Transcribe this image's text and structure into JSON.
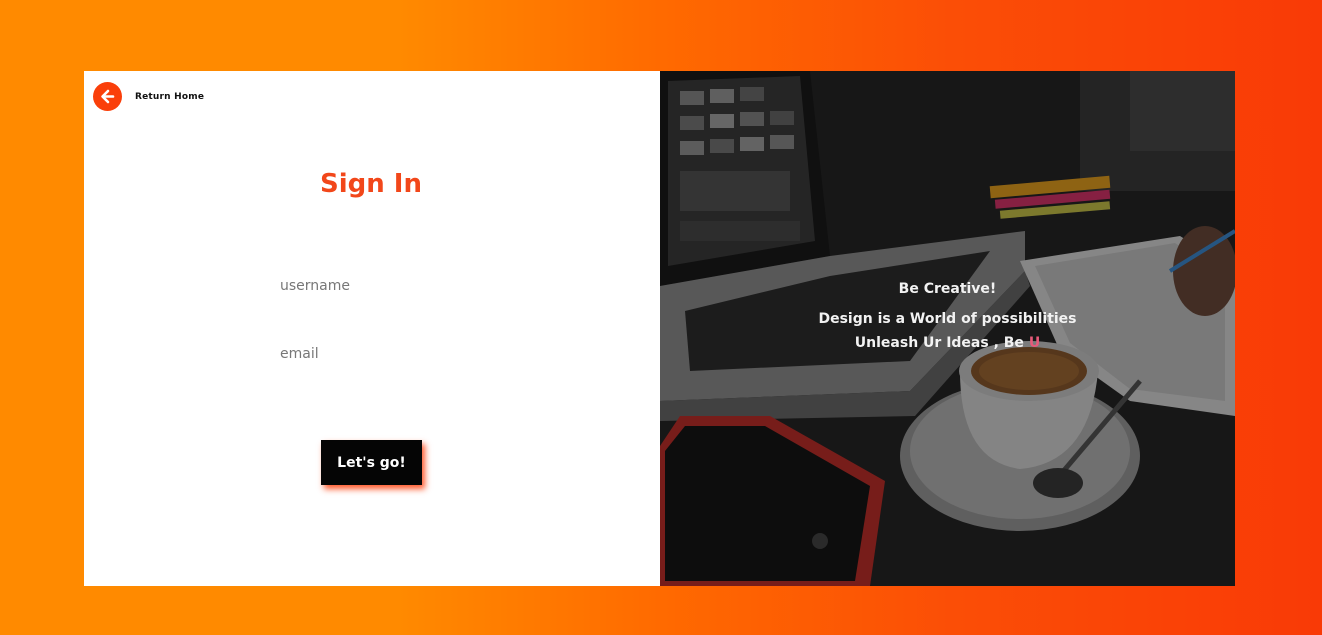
{
  "nav": {
    "return_label": "Return Home"
  },
  "form": {
    "title": "Sign In",
    "username_placeholder": "username",
    "email_placeholder": "email",
    "submit_label": "Let's go!"
  },
  "hero": {
    "line1": "Be Creative!",
    "line2": "Design is a World of possibilities",
    "line3_prefix": "Unleash Ur Ideas , Be ",
    "line3_accent": "U"
  },
  "colors": {
    "accent": "#f2471a",
    "background_gradient_start": "#ff8a00",
    "background_gradient_end": "#f93a06",
    "button_bg": "#050505",
    "accent_u": "#e85a7a"
  },
  "icons": {
    "back": "arrow-left-circle-icon"
  }
}
